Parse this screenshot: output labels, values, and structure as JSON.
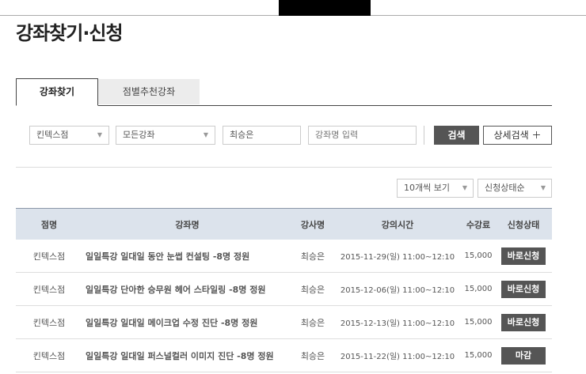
{
  "page_title": "강좌찾기·신청",
  "tabs": [
    {
      "label": "강좌찾기",
      "active": true
    },
    {
      "label": "점별추천강좌",
      "active": false
    }
  ],
  "search": {
    "branch": "킨텍스점",
    "category": "모든강좌",
    "teacher": "최승은",
    "keyword_placeholder": "강좌명 입력",
    "search_label": "검색",
    "detail_label": "상세검색 ＋"
  },
  "list_controls": {
    "page_size": "10개씩 보기",
    "sort": "신청상태순"
  },
  "table": {
    "headers": [
      "점명",
      "강좌명",
      "강사명",
      "강의시간",
      "수강료",
      "신청상태"
    ],
    "rows": [
      {
        "branch": "킨텍스점",
        "title": "일일특강 일대일 동안 눈썹 컨설팅 -8명 정원",
        "teacher": "최승은",
        "time": "2015-11-29(일) 11:00~12:10",
        "fee": "15,000",
        "status": "바로신청"
      },
      {
        "branch": "킨텍스점",
        "title": "일일특강 단아한 승무원 헤어 스타일링 -8명 정원",
        "teacher": "최승은",
        "time": "2015-12-06(일) 11:00~12:10",
        "fee": "15,000",
        "status": "바로신청"
      },
      {
        "branch": "킨텍스점",
        "title": "일일특강 일대일 메이크업 수정 진단 -8명 정원",
        "teacher": "최승은",
        "time": "2015-12-13(일) 11:00~12:10",
        "fee": "15,000",
        "status": "바로신청"
      },
      {
        "branch": "킨텍스점",
        "title": "일일특강 일대일 퍼스널컬러 이미지 진단 -8명 정원",
        "teacher": "최승은",
        "time": "2015-11-22(일) 11:00~12:10",
        "fee": "15,000",
        "status": "마감"
      }
    ]
  },
  "colors": {
    "button_dark": "#555555",
    "header_bg": "#dce3ec"
  }
}
